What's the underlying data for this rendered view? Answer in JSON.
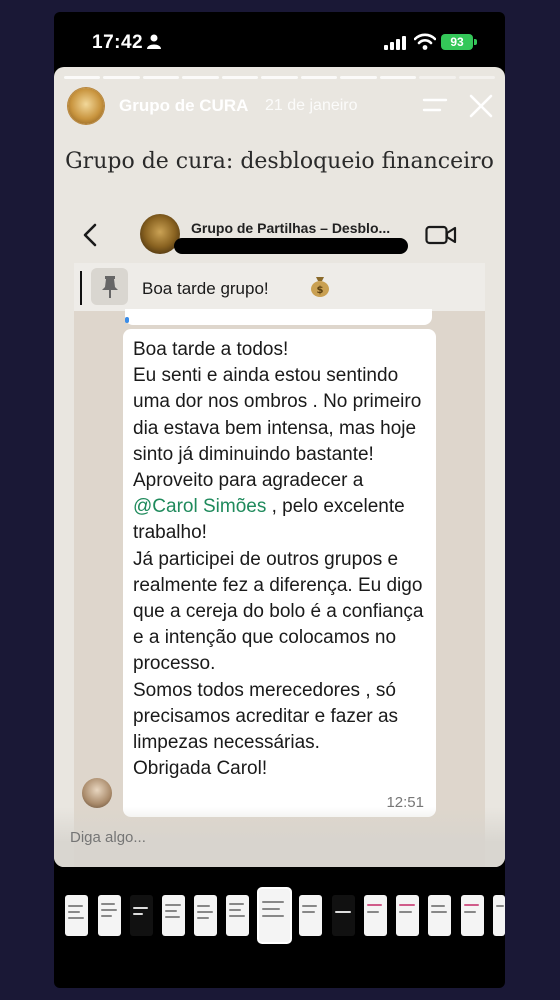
{
  "status_bar": {
    "time": "17:42",
    "battery": "93"
  },
  "story": {
    "author": "Grupo de CURA",
    "date": "21 de janeiro",
    "title": "Grupo de cura: desbloqueio financeiro",
    "reply_placeholder": "Diga algo..."
  },
  "chat": {
    "group_name": "Grupo de Partilhas – Desblo...",
    "pinned_message": "Boa tarde grupo!",
    "message_part1": "Boa tarde a todos!\nEu senti e ainda estou sentindo uma dor nos ombros . No primeiro dia estava bem intensa, mas hoje sinto já diminuindo bastante!\nAproveito para agradecer a ",
    "mention": "@Carol Simões",
    "message_part2": " , pelo excelente trabalho!\nJá participei de outros grupos e realmente fez a diferença. Eu digo que a cereja do bolo é a confiança e a intenção que colocamos no processo.\nSomos todos merecedores , só precisamos acreditar e fazer as limpezas necessárias.\nObrigada Carol!",
    "time": "12:51"
  },
  "icons": {
    "person": "person-icon",
    "signal": "signal-icon",
    "wifi": "wifi-icon",
    "menu": "menu-icon",
    "close": "close-icon",
    "back": "back-icon",
    "video": "video-call-icon",
    "pin": "pin-icon",
    "money_bag": "money-bag-icon"
  },
  "colors": {
    "mention": "#1f8a5c",
    "battery": "#34c759",
    "background": "#1a1836"
  }
}
